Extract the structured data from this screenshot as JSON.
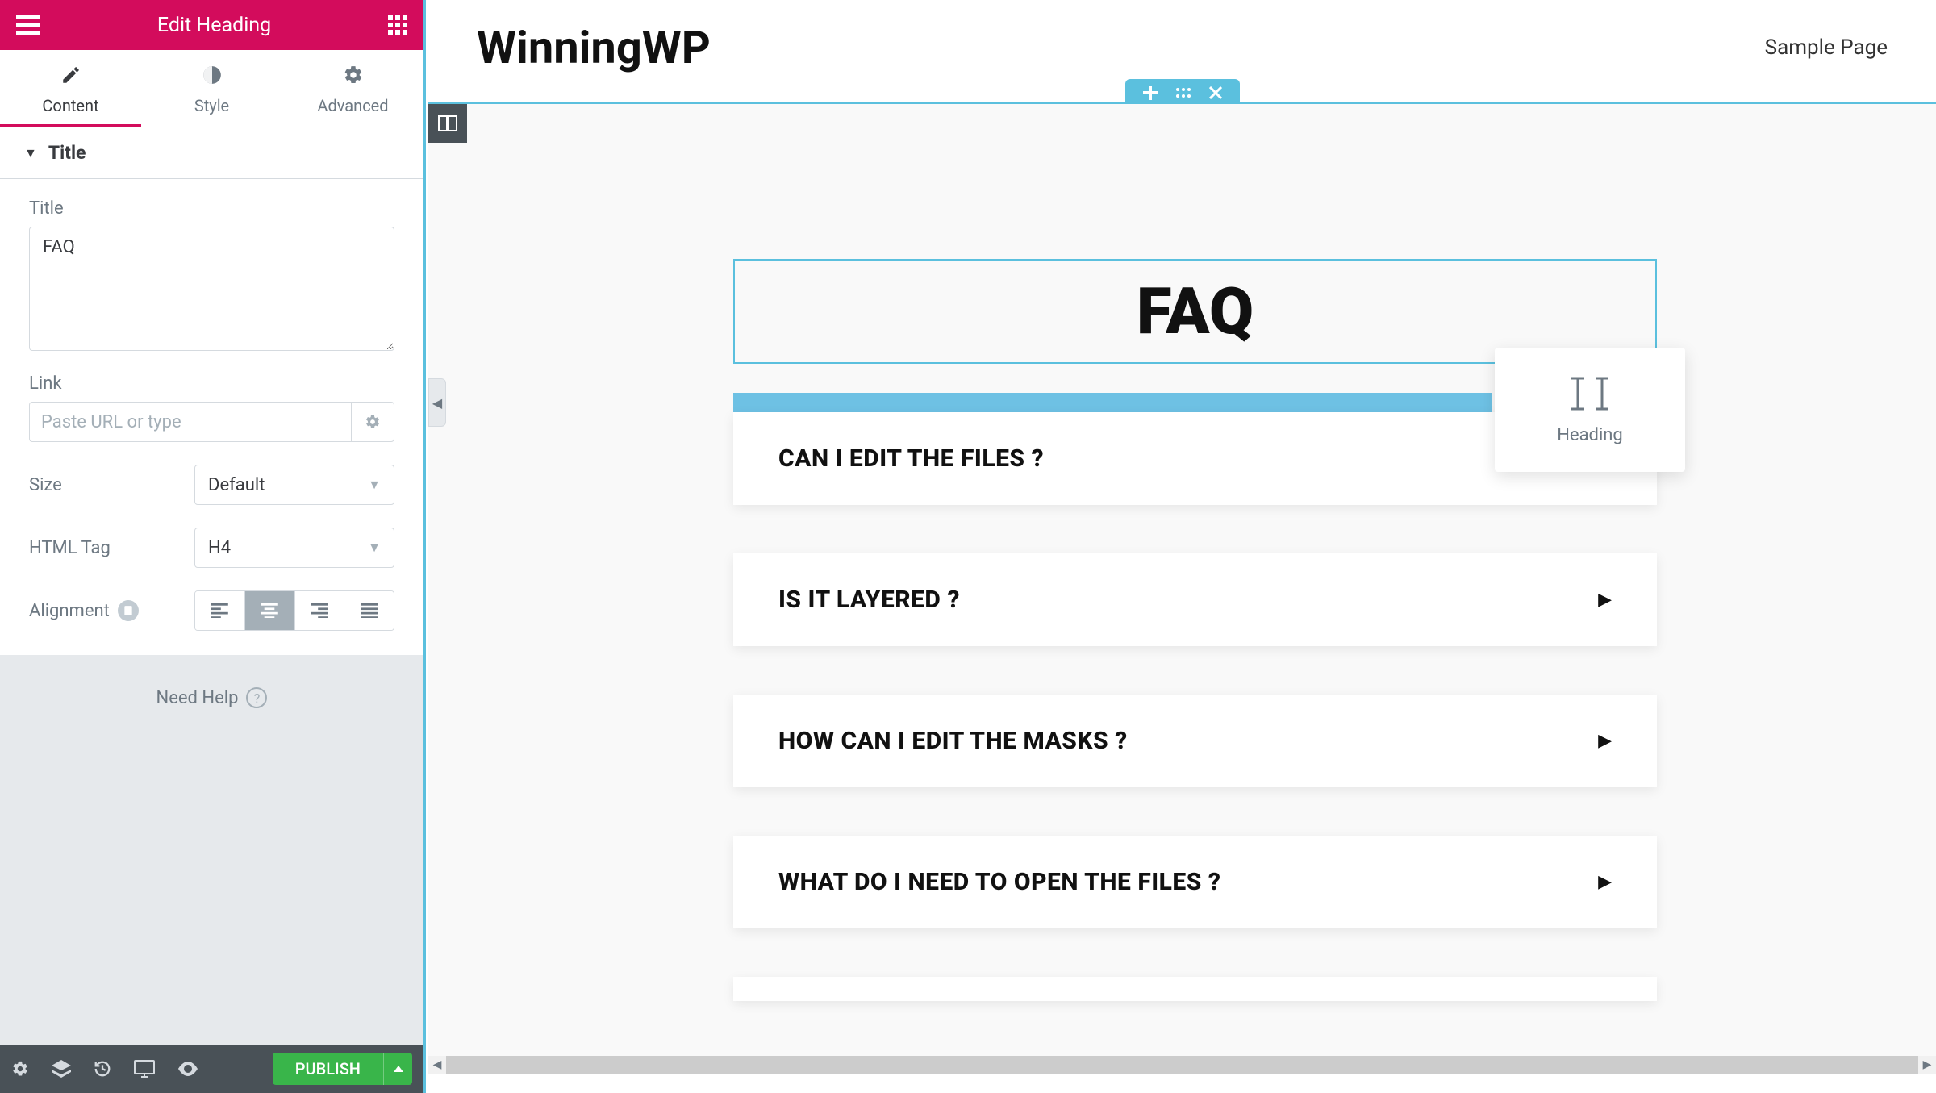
{
  "sidebar": {
    "header_title": "Edit Heading",
    "tabs": {
      "content": "Content",
      "style": "Style",
      "advanced": "Advanced"
    },
    "section_title": "Title",
    "fields": {
      "title_label": "Title",
      "title_value": "FAQ",
      "link_label": "Link",
      "link_placeholder": "Paste URL or type",
      "size_label": "Size",
      "size_value": "Default",
      "html_tag_label": "HTML Tag",
      "html_tag_value": "H4",
      "alignment_label": "Alignment",
      "alignment_options": [
        "left",
        "center",
        "right",
        "justify"
      ],
      "alignment_value": "center"
    },
    "help_text": "Need Help",
    "publish_label": "PUBLISH"
  },
  "preview": {
    "site_title": "WinningWP",
    "nav_link": "Sample Page",
    "faq_heading": "FAQ",
    "accordion": [
      "CAN I EDIT THE FILES ?",
      "IS IT LAYERED ?",
      "HOW CAN I EDIT THE MASKS ?",
      "WHAT DO I NEED TO OPEN THE FILES ?"
    ],
    "drag_widget_label": "Heading"
  },
  "colors": {
    "brand_pink": "#d30c5c",
    "brand_blue": "#5bc0de",
    "accent_bar": "#6ec1e4",
    "publish_green": "#39b54a",
    "footer_dark": "#495157"
  }
}
